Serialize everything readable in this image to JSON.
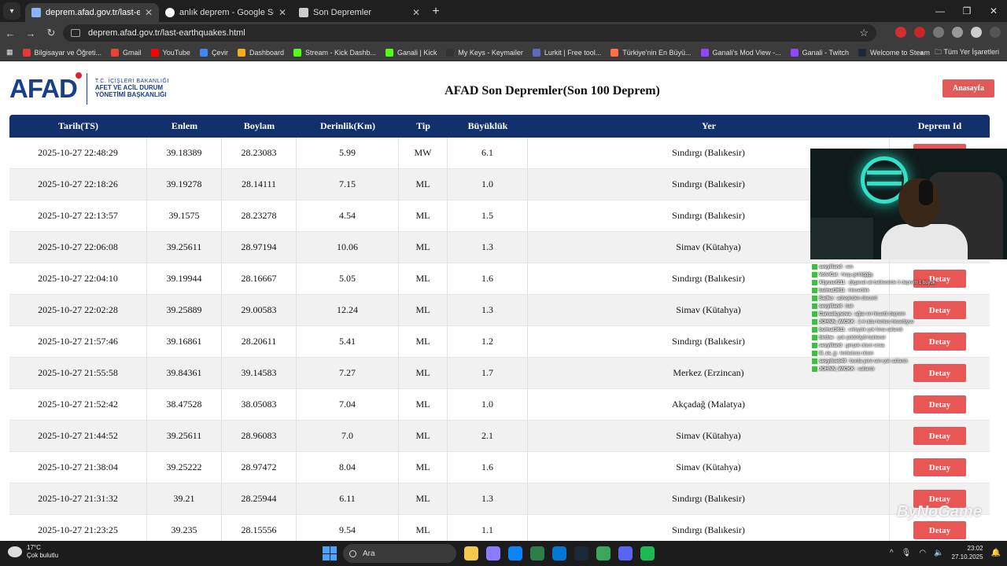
{
  "browser": {
    "tabs": [
      {
        "title": "deprem.afad.gov.tr/last-earthq",
        "active": true
      },
      {
        "title": "anlık deprem - Google Search",
        "active": false
      },
      {
        "title": "Son Depremler",
        "active": false
      }
    ],
    "url": "deprem.afad.gov.tr/last-earthquakes.html",
    "bookmarks": [
      {
        "label": "Bilgisayar ve Öğreti...",
        "color": "#e53935"
      },
      {
        "label": "Gmail",
        "color": "#ea4335"
      },
      {
        "label": "YouTube",
        "color": "#ff0000"
      },
      {
        "label": "Çevir",
        "color": "#4285f4"
      },
      {
        "label": "Dashboard",
        "color": "#f9a825"
      },
      {
        "label": "Stream - Kick Dashb...",
        "color": "#53fc18"
      },
      {
        "label": "Ganali | Kick",
        "color": "#53fc18"
      },
      {
        "label": "My Keys - Keymailer",
        "color": "#333333"
      },
      {
        "label": "Lurkit | Free tool...",
        "color": "#5c6bc0"
      },
      {
        "label": "Türkiye'nin En Büyü...",
        "color": "#ff7043"
      },
      {
        "label": "Ganali's Mod View -...",
        "color": "#9146ff"
      },
      {
        "label": "Ganali - Twitch",
        "color": "#9146ff"
      },
      {
        "label": "Welcome to Steam",
        "color": "#1b2838"
      }
    ],
    "all_bookmarks": "Tüm Yer İşaretleri"
  },
  "page": {
    "logo": "AFAD",
    "logo_line1": "T.C. İÇİŞLERİ BAKANLIĞI",
    "logo_line2": "AFET VE ACİL DURUM",
    "logo_line3": "YÖNETİMİ BAŞKANLIĞI",
    "title": "AFAD Son Depremler(Son 100 Deprem)",
    "home_button": "Anasayfa",
    "detail_button": "Detay"
  },
  "table": {
    "headers": [
      "Tarih(TS)",
      "Enlem",
      "Boylam",
      "Derinlik(Km)",
      "Tip",
      "Büyüklük",
      "Yer",
      "Deprem Id"
    ],
    "rows": [
      [
        "2025-10-27 22:48:29",
        "39.18389",
        "28.23083",
        "5.99",
        "MW",
        "6.1",
        "Sındırgı (Balıkesir)"
      ],
      [
        "2025-10-27 22:18:26",
        "39.19278",
        "28.14111",
        "7.15",
        "ML",
        "1.0",
        "Sındırgı (Balıkesir)"
      ],
      [
        "2025-10-27 22:13:57",
        "39.1575",
        "28.23278",
        "4.54",
        "ML",
        "1.5",
        "Sındırgı (Balıkesir)"
      ],
      [
        "2025-10-27 22:06:08",
        "39.25611",
        "28.97194",
        "10.06",
        "ML",
        "1.3",
        "Simav (Kütahya)"
      ],
      [
        "2025-10-27 22:04:10",
        "39.19944",
        "28.16667",
        "5.05",
        "ML",
        "1.6",
        "Sındırgı (Balıkesir)"
      ],
      [
        "2025-10-27 22:02:28",
        "39.25889",
        "29.00583",
        "12.24",
        "ML",
        "1.3",
        "Simav (Kütahya)"
      ],
      [
        "2025-10-27 21:57:46",
        "39.16861",
        "28.20611",
        "5.41",
        "ML",
        "1.2",
        "Sındırgı (Balıkesir)"
      ],
      [
        "2025-10-27 21:55:58",
        "39.84361",
        "39.14583",
        "7.27",
        "ML",
        "1.7",
        "Merkez (Erzincan)"
      ],
      [
        "2025-10-27 21:52:42",
        "38.47528",
        "38.05083",
        "7.04",
        "ML",
        "1.0",
        "Akçadağ (Malatya)"
      ],
      [
        "2025-10-27 21:44:52",
        "39.25611",
        "28.96083",
        "7.0",
        "ML",
        "2.1",
        "Simav (Kütahya)"
      ],
      [
        "2025-10-27 21:38:04",
        "39.25222",
        "28.97472",
        "8.04",
        "ML",
        "1.6",
        "Simav (Kütahya)"
      ],
      [
        "2025-10-27 21:31:32",
        "39.21",
        "28.25944",
        "6.11",
        "ML",
        "1.3",
        "Sındırgı (Balıkesir)"
      ],
      [
        "2025-10-27 21:23:25",
        "39.235",
        "28.15556",
        "9.54",
        "ML",
        "1.1",
        "Sındırgı (Balıkesir)"
      ]
    ]
  },
  "chat": [
    {
      "user": "sesyilland",
      "text": "ses"
    },
    {
      "user": "VolviCat",
      "text": "hoşş geldiğğğş"
    },
    {
      "user": "X1yusuf211",
      "text": "@ganali ali balikesirde 3 deprem 1 büyük"
    },
    {
      "user": "bulmat3611",
      "text": "hiissettikk"
    },
    {
      "user": "Sadko",
      "text": "adreşinden discord"
    },
    {
      "user": "sesyilland",
      "text": "balı"
    },
    {
      "user": "CansuiLysova",
      "text": "ağlar en hissetti deprem"
    },
    {
      "user": "JOHNN_WICKK",
      "text": "2.4 oldu herkes hissettiyse"
    },
    {
      "user": "bulmat3611",
      "text": "sıktıydık çok fena sallandı"
    },
    {
      "user": "birdne",
      "text": "çok şiddetliydi balıkesir"
    },
    {
      "user": "sesyilland",
      "text": "gerçek olsun sıraa"
    },
    {
      "user": "lil_ss_g",
      "text": "korkutucu olsun"
    },
    {
      "user": "sesydoeb49",
      "text": "burda yere sen çok sallandı"
    },
    {
      "user": "JOHNN_WICKK",
      "text": "sallandı"
    }
  ],
  "watermark": "ByNoGame",
  "taskbar": {
    "temp": "17°C",
    "weather": "Çok bulutlu",
    "search": "Ara",
    "time": "23:02",
    "date": "27.10.2025",
    "icon_colors": [
      "#f2c94c",
      "#8a7cff",
      "#0a84ff",
      "#2d7d46",
      "#0078d4",
      "#1b2838",
      "#3ba55d",
      "#5865f2",
      "#1db954"
    ]
  }
}
